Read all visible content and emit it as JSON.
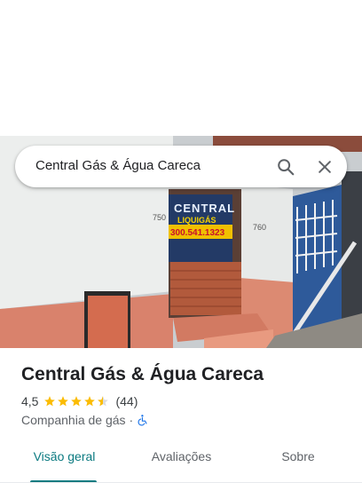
{
  "search": {
    "query": "Central Gás & Água Careca"
  },
  "photo": {
    "sign_line1": "CENTRAL",
    "sign_line2": "LIQUIGÁS",
    "sign_phone": "300.541.1323",
    "number_left": "750",
    "number_right": "760"
  },
  "place": {
    "name": "Central Gás & Água Careca",
    "rating": "4,5",
    "stars": 4.5,
    "review_count": "(44)",
    "category": "Companhia de gás",
    "separator": "·"
  },
  "tabs": [
    {
      "label": "Visão geral",
      "selected": true
    },
    {
      "label": "Avaliações",
      "selected": false
    },
    {
      "label": "Sobre",
      "selected": false
    }
  ],
  "colors": {
    "accent": "#0b7a80",
    "star": "#fbbc04",
    "accessibility": "#1a73e8"
  },
  "icons": {
    "search": "search-icon",
    "close": "close-icon",
    "accessibility": "wheelchair-icon"
  }
}
